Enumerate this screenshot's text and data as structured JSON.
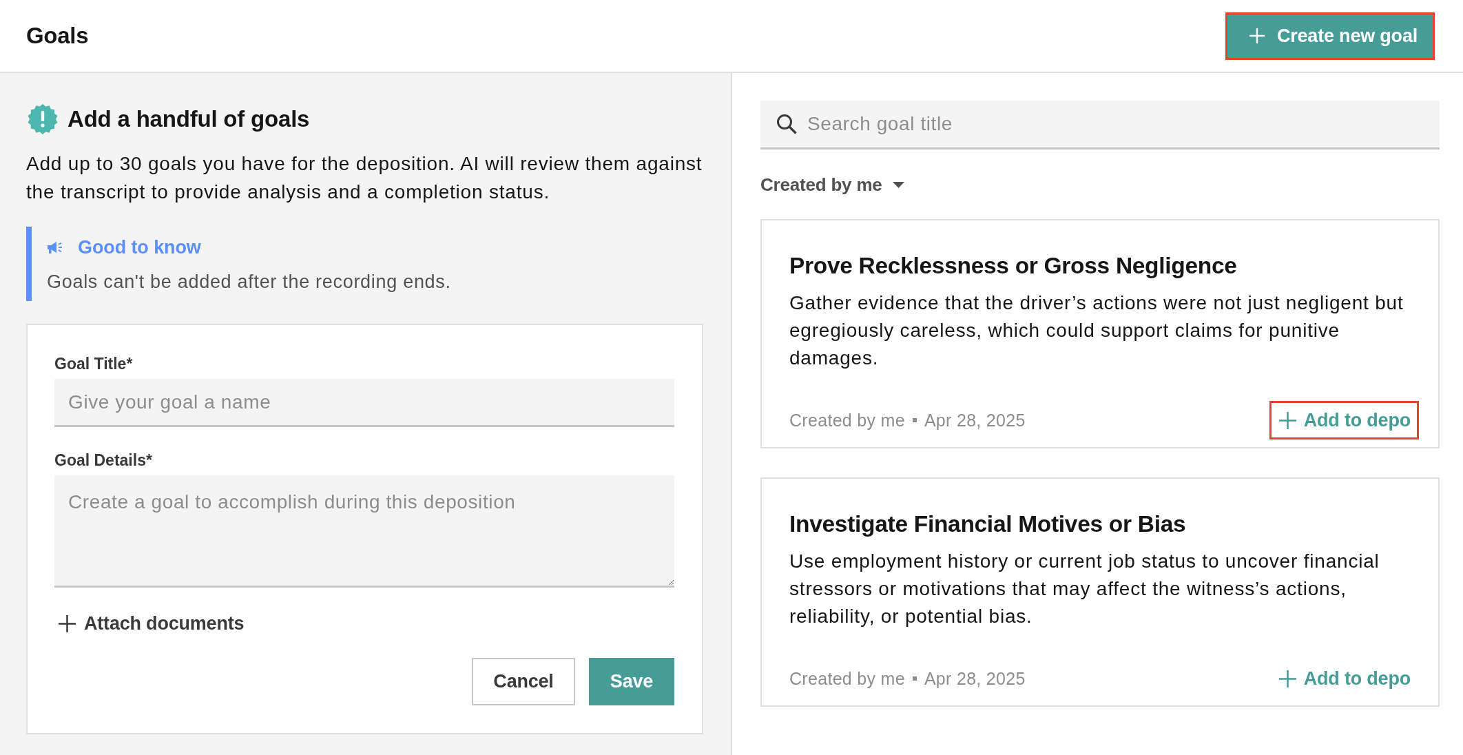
{
  "header": {
    "title": "Goals",
    "create_button": {
      "label": "Create new goal",
      "highlighted": true
    }
  },
  "form_panel": {
    "heading": "Add a handful of goals",
    "description": "Add up to 30 goals you have for the deposition. AI will review them against the transcript to provide analysis and a completion status.",
    "callout": {
      "title": "Good to know",
      "text": "Goals can't be added after the recording ends."
    },
    "form": {
      "fields": [
        {
          "kind": "input",
          "label": "Goal Title*",
          "placeholder": "Give your goal a name"
        },
        {
          "kind": "textarea",
          "label": "Goal Details*",
          "placeholder": "Create a goal to accomplish during this deposition"
        }
      ],
      "attach_label": "Attach documents",
      "buttons": [
        {
          "kind": "secondary",
          "label": "Cancel"
        },
        {
          "kind": "primary",
          "label": "Save"
        }
      ]
    }
  },
  "library": {
    "search": {
      "placeholder": "Search goal title"
    },
    "filter": {
      "label": "Created by me"
    },
    "goals": [
      {
        "title": "Prove Recklessness or Gross Negligence",
        "description": "Gather evidence that the driver’s actions were not just negligent but egregiously careless, which could support claims for punitive damages.",
        "author": "Created by me",
        "date": "Apr 28, 2025",
        "action": {
          "label": "Add to depo",
          "highlighted": true
        }
      },
      {
        "title": "Investigate Financial Motives or Bias",
        "description": "Use employment history or current job status to uncover financial stressors or motivations that may affect the witness’s actions, reliability, or potential bias.",
        "author": "Created by me",
        "date": "Apr 28, 2025",
        "action": {
          "label": "Add to depo",
          "highlighted": false
        }
      }
    ]
  }
}
